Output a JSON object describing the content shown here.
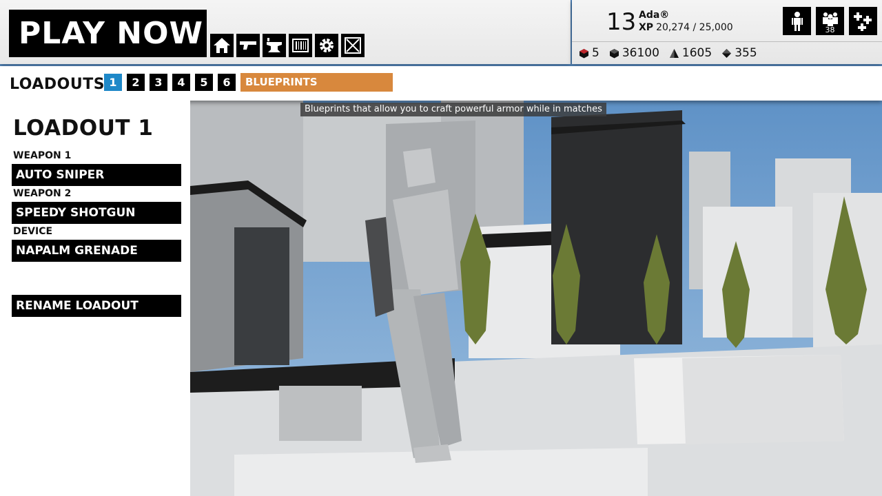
{
  "top": {
    "play_now": "PLAY NOW",
    "nav_icons": [
      "home-icon",
      "weapon-icon",
      "anvil-icon",
      "barcode-icon",
      "gear-icon",
      "close-icon"
    ]
  },
  "player": {
    "level": "13",
    "name": "Ada®",
    "xp_label": "XP",
    "xp": "20,274 / 25,000",
    "currencies": [
      {
        "icon": "red-cube-icon",
        "value": "5"
      },
      {
        "icon": "cube-icon",
        "value": "36100"
      },
      {
        "icon": "pyramid-icon",
        "value": "1605"
      },
      {
        "icon": "diamond-icon",
        "value": "355"
      }
    ],
    "icons": [
      {
        "name": "character-icon",
        "badge": ""
      },
      {
        "name": "squad-icon",
        "badge": "38"
      },
      {
        "name": "add-friend-icon",
        "badge": ""
      }
    ]
  },
  "loadouts": {
    "title": "LOADOUTS",
    "tabs": [
      "1",
      "2",
      "3",
      "4",
      "5",
      "6"
    ],
    "active_tab": "1",
    "blueprints": "BLUEPRINTS"
  },
  "panel": {
    "title": "LOADOUT 1",
    "weapon1_label": "WEAPON 1",
    "weapon1": "AUTO SNIPER",
    "weapon2_label": "WEAPON 2",
    "weapon2": "SPEEDY SHOTGUN",
    "device_label": "DEVICE",
    "device": "NAPALM GRENADE",
    "rename": "RENAME LOADOUT"
  },
  "tooltip": "Blueprints that allow you to craft powerful armor while in matches",
  "colors": {
    "accent_blue": "#1e88c8",
    "blueprints_orange": "#d8883d",
    "sky": "#5e8fc2",
    "tree_green": "#6b7a35"
  }
}
